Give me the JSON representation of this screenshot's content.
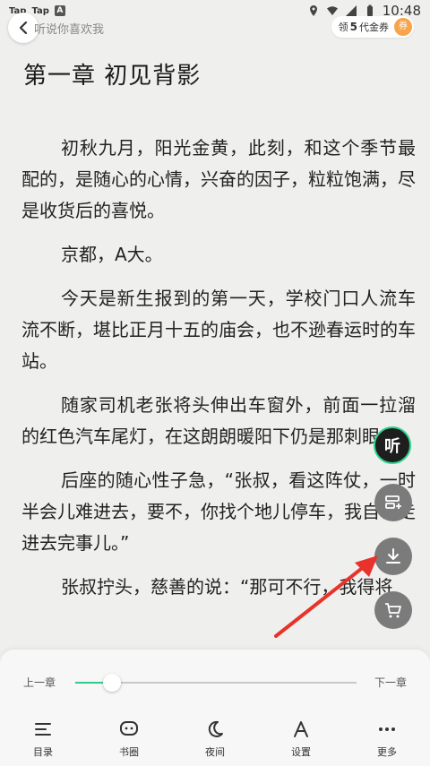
{
  "status_bar": {
    "left_items": [
      "Tap",
      "Tap",
      "A"
    ],
    "time": "10:48"
  },
  "header": {
    "book_title": "听说你喜欢我",
    "coupon_prefix": "领",
    "coupon_count": "5",
    "coupon_suffix": "代金券",
    "coupon_icon": "券"
  },
  "chapter": {
    "title": "第一章 初见背影",
    "paragraphs": [
      "初秋九月，阳光金黄，此刻，和这个季节最配的，是随心的心情，兴奋的因子，粒粒饱满，尽是收货后的喜悦。",
      "京都，A大。",
      "今天是新生报到的第一天，学校门口人流车流不断，堪比正月十五的庙会，也不逊春运时的车站。",
      "随家司机老张将头伸出车窗外，前面一拉溜的红色汽车尾灯，在这朗朗暖阳下仍是那刺眼。",
      "后座的随心性子急，“张叔，看这阵仗，一时半会儿难进去，要不，你找个地儿停车，我自己走进去完事儿。”",
      "张叔拧头，慈善的说：“那可不行，我得将"
    ]
  },
  "floating": {
    "listen_label": "听",
    "icons": [
      "add-to-shelf-icon",
      "download-icon",
      "cart-icon"
    ],
    "accent": "#2ed38c"
  },
  "panel": {
    "prev_chapter": "上一章",
    "next_chapter": "下一章",
    "progress": 0.13,
    "accent": "#2ecc8a",
    "tools": [
      {
        "label": "目录",
        "icon": "menu-list-icon"
      },
      {
        "label": "书圈",
        "icon": "chat-bubble-icon"
      },
      {
        "label": "夜间",
        "icon": "moon-icon"
      },
      {
        "label": "设置",
        "icon": "font-a-icon"
      },
      {
        "label": "更多",
        "icon": "more-dots-icon"
      }
    ]
  }
}
